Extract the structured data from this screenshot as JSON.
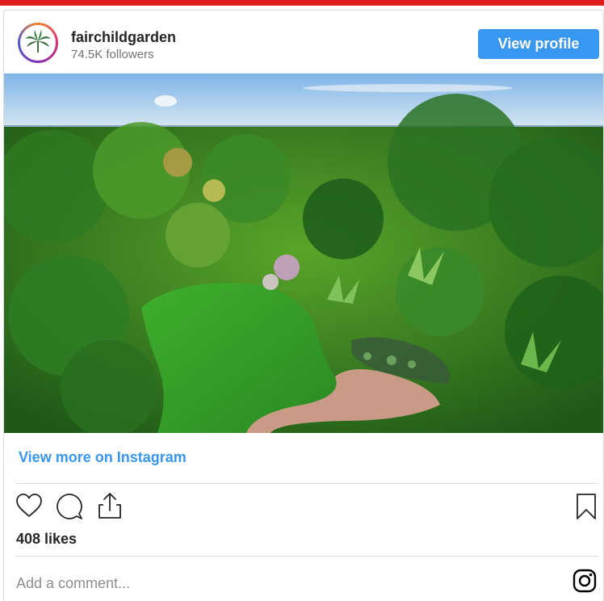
{
  "post": {
    "username": "fairchildgarden",
    "followers": "74.5K followers",
    "view_profile_label": "View profile",
    "view_more_label": "View more on Instagram",
    "likes": "408 likes",
    "comment_placeholder": "Add a comment..."
  },
  "icons": {
    "like": "heart-icon",
    "comment": "comment-bubble-icon",
    "share": "share-icon",
    "save": "bookmark-icon",
    "brand": "instagram-icon"
  },
  "colors": {
    "accent": "#3897f0",
    "top_bar": "#e01b1b",
    "text": "#262626",
    "muted": "#737373",
    "divider": "#dbdbdb"
  }
}
